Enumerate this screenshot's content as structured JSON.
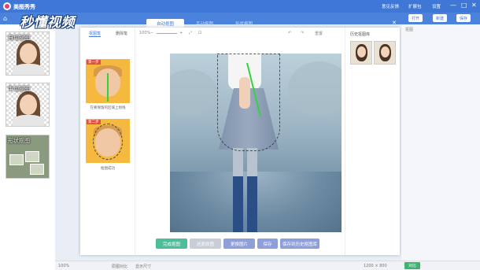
{
  "app": {
    "title": "美图秀秀"
  },
  "watermark": "秒懂视频",
  "titlebar": {
    "items": [
      "意见反馈",
      "扩展包",
      "设置"
    ],
    "controls": [
      "—",
      "□",
      "✕"
    ]
  },
  "navbar": {
    "right_buttons": [
      "打开",
      "新建",
      "保存"
    ]
  },
  "sidebar": {
    "items": [
      {
        "label": "自动抠图"
      },
      {
        "label": "手动抠图"
      },
      {
        "label": "形状抠图"
      }
    ]
  },
  "dialog": {
    "tabs": [
      "自动抠图",
      "手动抠图",
      "形状抠图"
    ],
    "active_tab": "自动抠图",
    "subtabs": [
      "抠图笔",
      "删除笔"
    ],
    "zoom": "100%",
    "toolbar_right": [
      "↶",
      "↷",
      "重置"
    ],
    "cards": [
      {
        "badge": "第一步",
        "caption": "在要保留的区域上划线"
      },
      {
        "badge": "第二步",
        "caption": "抠图成功"
      }
    ],
    "history_title": "历史抠图库",
    "buttons": [
      {
        "label": "完成抠图",
        "color": "#4dbd9a"
      },
      {
        "label": "还原原图",
        "color": "#c8cdd6"
      },
      {
        "label": "更换图片",
        "color": "#8f9fd9"
      },
      {
        "label": "保存",
        "color": "#8f9fd9"
      },
      {
        "label": "保存到历史抠图库",
        "color": "#8f9fd9"
      }
    ]
  },
  "right_panel": {
    "label": "抠图"
  },
  "statusbar": {
    "zoom": "100%",
    "items": [
      "原图对比",
      "显示尺寸"
    ],
    "size": "1200 × 800",
    "green_button": "对比"
  }
}
